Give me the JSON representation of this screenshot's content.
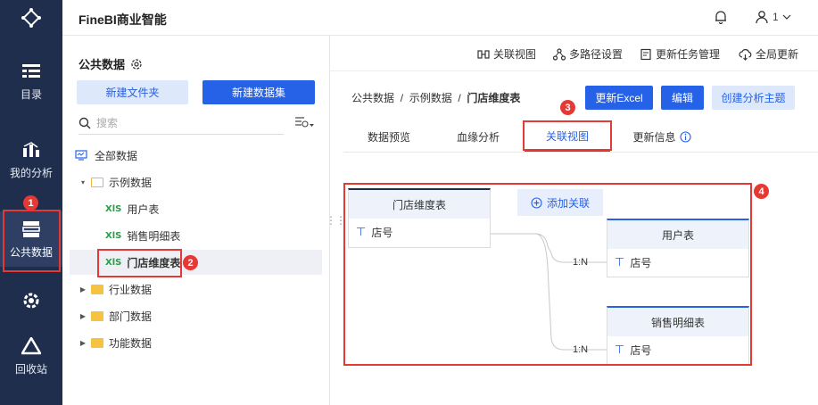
{
  "app": {
    "title": "FineBI商业智能",
    "user_label": "1"
  },
  "nav": {
    "items": [
      {
        "label": "目录",
        "icon": "catalog-icon"
      },
      {
        "label": "我的分析",
        "icon": "analysis-icon"
      },
      {
        "label": "公共数据",
        "icon": "public-data-icon"
      },
      {
        "label": "",
        "icon": "settings-icon"
      },
      {
        "label": "回收站",
        "icon": "recycle-icon"
      }
    ]
  },
  "left_panel": {
    "title": "公共数据",
    "new_folder": "新建文件夹",
    "new_dataset": "新建数据集",
    "search_placeholder": "搜索",
    "tree": [
      {
        "label": "全部数据",
        "type": "root"
      },
      {
        "label": "示例数据",
        "type": "folder-open"
      },
      {
        "label": "用户表",
        "type": "table"
      },
      {
        "label": "销售明细表",
        "type": "table"
      },
      {
        "label": "门店维度表",
        "type": "table",
        "selected": true
      },
      {
        "label": "行业数据",
        "type": "folder"
      },
      {
        "label": "部门数据",
        "type": "folder"
      },
      {
        "label": "功能数据",
        "type": "folder"
      }
    ],
    "xls_glyph": "XlS"
  },
  "toolbar": {
    "items": [
      "关联视图",
      "多路径设置",
      "更新任务管理",
      "全局更新"
    ]
  },
  "breadcrumb": {
    "a": "公共数据",
    "sep": "/",
    "b": "示例数据",
    "c": "门店维度表"
  },
  "actions": {
    "update_excel": "更新Excel",
    "edit": "编辑",
    "create_topic": "创建分析主题"
  },
  "tabs": [
    "数据预览",
    "血缘分析",
    "关联视图",
    "更新信息"
  ],
  "relation_view": {
    "main_table": {
      "name": "门店维度表",
      "field": "店号"
    },
    "add_relation": "添加关联",
    "related": [
      {
        "name": "用户表",
        "field": "店号",
        "ratio": "1:N"
      },
      {
        "name": "销售明细表",
        "field": "店号",
        "ratio": "1:N"
      }
    ]
  },
  "badges": [
    "1",
    "2",
    "3",
    "4"
  ],
  "colors": {
    "nav_bg": "#1f2e4d",
    "primary": "#2662e8",
    "highlight": "#e53935"
  }
}
